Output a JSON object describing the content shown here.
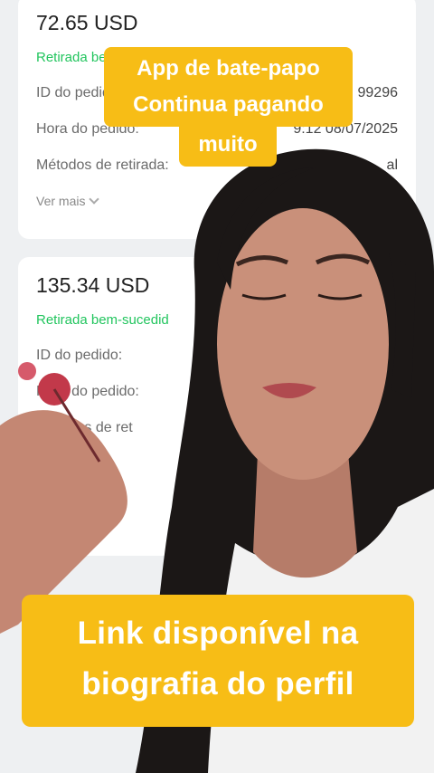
{
  "withdrawals": [
    {
      "amount": "72.65 USD",
      "status": "Retirada bem-sucedida",
      "order_id_label": "ID do pedido:",
      "order_id_value": "99296",
      "order_time_label": "Hora do pedido:",
      "order_time_value": "9:12 08/07/2025",
      "method_label": "Métodos de retirada:",
      "method_value": "al",
      "see_more": "Ver mais"
    },
    {
      "amount": "135.34 USD",
      "status": "Retirada bem-sucedid",
      "order_id_label": "ID do pedido:",
      "order_time_label": "Hora do pedido:",
      "method_label": "Métodos de ret"
    }
  ],
  "captions": {
    "top_line1": "App de bate-papo",
    "top_line2": "Continua pagando",
    "top_line3": "muito",
    "bottom_line1": "Link disponível na",
    "bottom_line2": "biografia do perfil"
  },
  "colors": {
    "banner": "#f7bd16",
    "success": "#22c55e",
    "hair": "#1b1716",
    "skin": "#c9907a"
  }
}
